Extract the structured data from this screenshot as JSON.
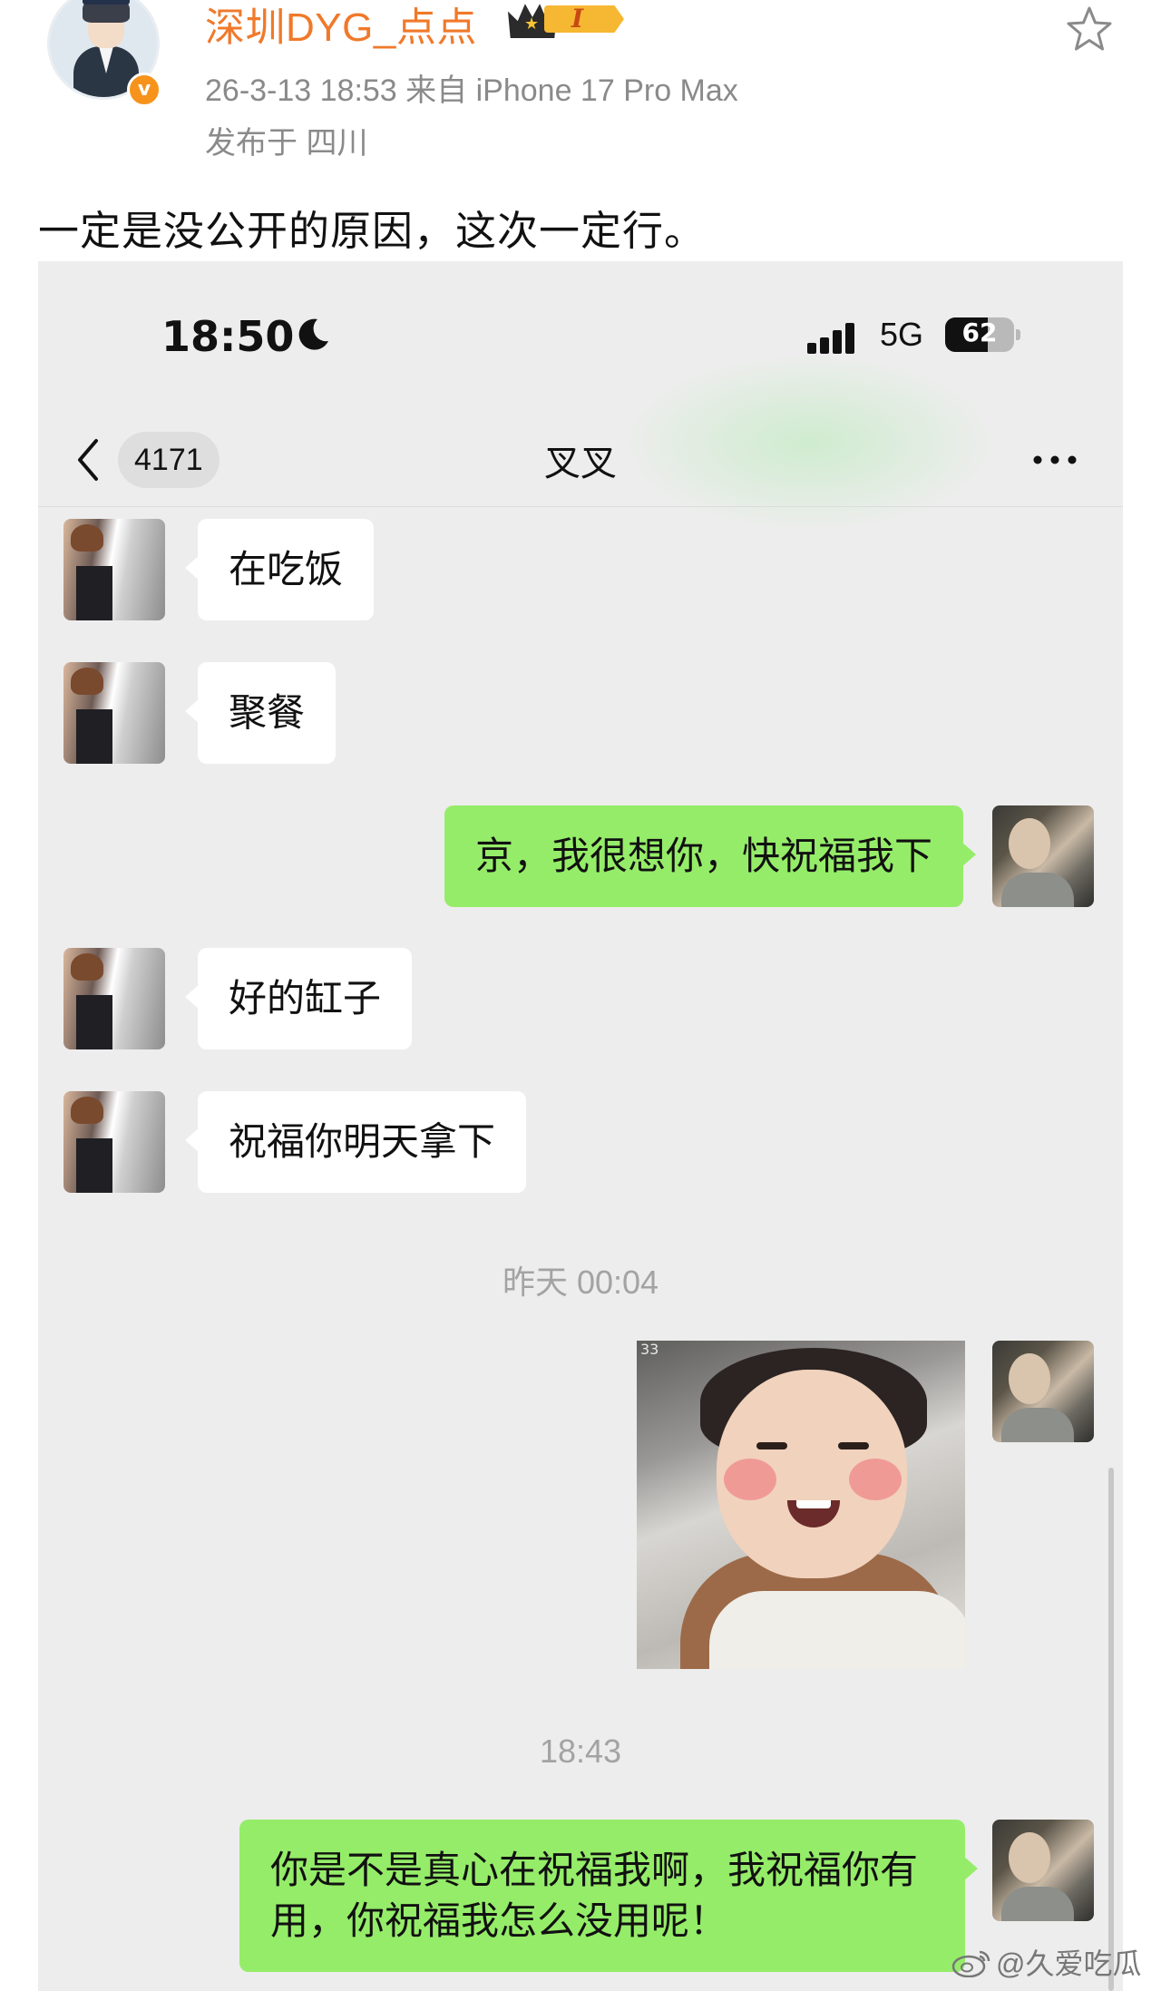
{
  "post": {
    "username": "深圳DYG_点点",
    "badge_level": "I",
    "meta": "26-3-13 18:53   来自 iPhone 17 Pro Max",
    "location": "发布于 四川",
    "text": "一定是没公开的原因，这次一定行。",
    "verified_mark": "v"
  },
  "screenshot": {
    "status": {
      "time": "18:50",
      "network": "5G",
      "battery": "62",
      "battery_level": 62
    },
    "nav": {
      "unread_count": "4171",
      "chat_title": "叉叉"
    },
    "messages": [
      {
        "side": "in",
        "text": "在吃饭"
      },
      {
        "side": "in",
        "text": "聚餐"
      },
      {
        "side": "out",
        "text": "京，我很想你，快祝福我下"
      },
      {
        "side": "in",
        "text": "好的缸子"
      },
      {
        "side": "in",
        "text": "祝福你明天拿下"
      },
      {
        "side": "out",
        "text": "你是不是真心在祝福我啊，我祝福你有用，你祝福我怎么没用呢！"
      }
    ],
    "timestamps": [
      "昨天 00:04",
      "18:43"
    ],
    "photo_corner_label": "33"
  },
  "watermark": "@久爱吃瓜",
  "colors": {
    "username": "#f0792a",
    "bubble_out": "#95ec69",
    "bubble_in": "#ffffff",
    "chat_bg": "#ededed"
  }
}
